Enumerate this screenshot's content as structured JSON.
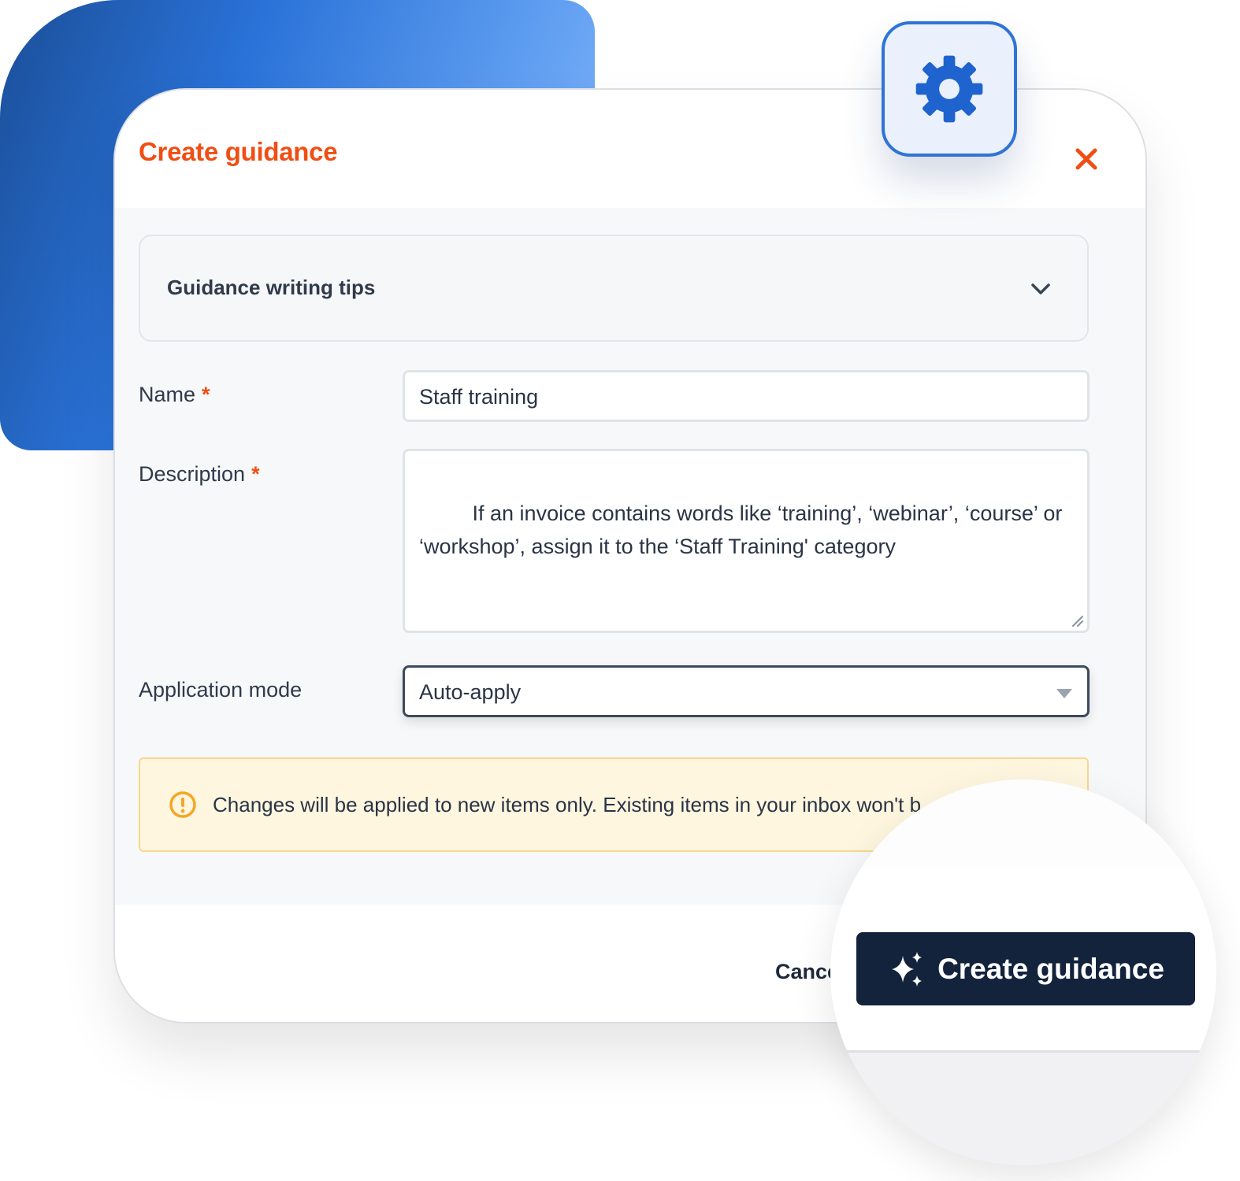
{
  "modal": {
    "title": "Create guidance",
    "close_icon": "close-icon"
  },
  "tips": {
    "label": "Guidance writing tips",
    "icon": "chevron-down-icon"
  },
  "form": {
    "name": {
      "label": "Name",
      "required_mark": "*",
      "value": "Staff training"
    },
    "description": {
      "label": "Description",
      "required_mark": "*",
      "value": " If an invoice contains words like ‘training’, ‘webinar’, ‘course’ or ‘workshop’, assign it to the ‘Staff Training' category"
    },
    "application_mode": {
      "label": "Application mode",
      "value": "Auto-apply"
    }
  },
  "notice": {
    "text": "Changes will be applied to new items only. Existing items in your inbox won't b",
    "icon": "warning-icon"
  },
  "footer": {
    "cancel_label": "Cancel",
    "create_label": "Create guidance",
    "create_icon": "sparkles-icon"
  },
  "badge": {
    "icon": "gear-icon"
  },
  "colors": {
    "accent": "#f04e13",
    "primary_button": "#13233c",
    "badge_border": "#2f74d6",
    "gear": "#1f63cf",
    "warning": "#f5a623",
    "notice_bg": "#fff6e0"
  }
}
